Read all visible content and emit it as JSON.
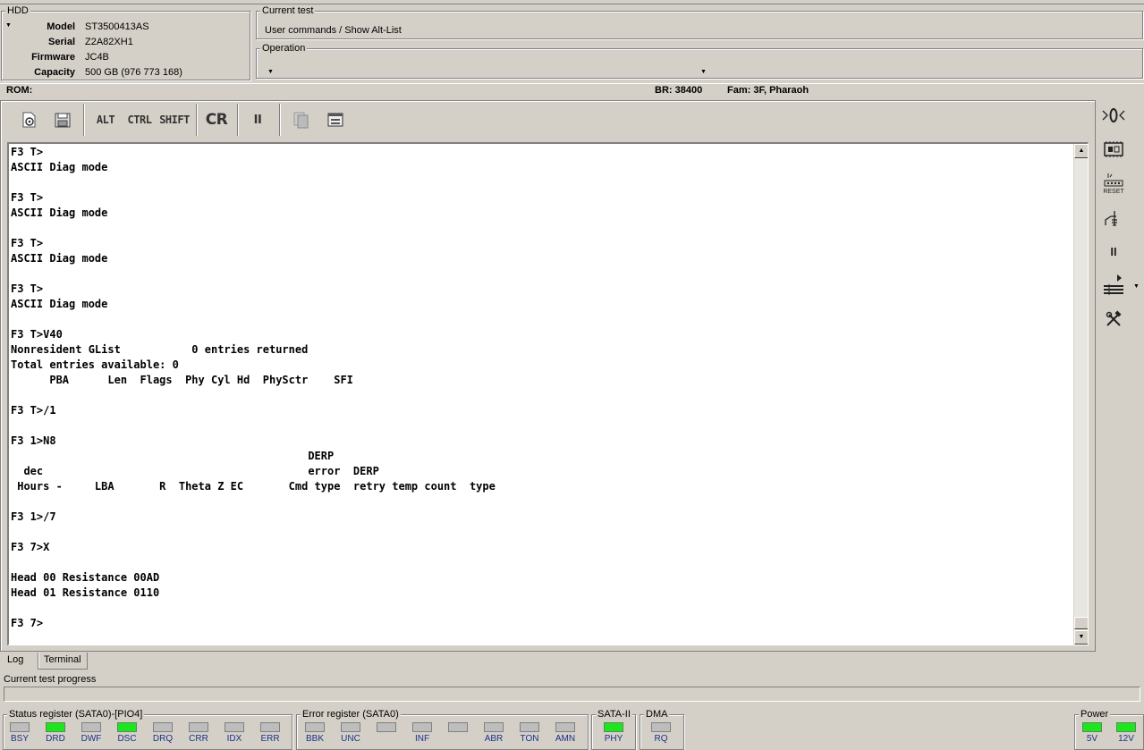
{
  "hdd": {
    "title": "HDD",
    "rows": [
      {
        "label": "Model",
        "value": "ST3500413AS"
      },
      {
        "label": "Serial",
        "value": "Z2A82XH1"
      },
      {
        "label": "Firmware",
        "value": "JC4B"
      },
      {
        "label": "Capacity",
        "value": "500 GB (976 773 168)"
      }
    ]
  },
  "current_test": {
    "title": "Current test",
    "value": "User commands / Show Alt-List"
  },
  "operation": {
    "title": "Operation",
    "value": ""
  },
  "infobar": {
    "rom": "ROM:",
    "br": "BR: 38400",
    "fam": "Fam: 3F, Pharaoh"
  },
  "toolbar": {
    "alt": "ALT",
    "ctrl": "CTRL",
    "shift": "SHIFT",
    "cr": "CR",
    "pause": "II"
  },
  "terminal": {
    "lines": [
      "F3 T>",
      "ASCII Diag mode",
      "",
      "F3 T>",
      "ASCII Diag mode",
      "",
      "F3 T>",
      "ASCII Diag mode",
      "",
      "F3 T>",
      "ASCII Diag mode",
      "",
      "F3 T>V40",
      "Nonresident GList           0 entries returned",
      "Total entries available: 0",
      "      PBA      Len  Flags  Phy Cyl Hd  PhySctr    SFI",
      "",
      "F3 T>/1",
      "",
      "F3 1>N8",
      "                                              DERP",
      "  dec                                         error  DERP",
      " Hours -     LBA       R  Theta Z EC       Cmd type  retry temp count  type",
      "",
      "F3 1>/7",
      "",
      "F3 7>X",
      "",
      "Head 00 Resistance 00AD",
      "Head 01 Resistance 0110",
      "",
      "F3 7>"
    ]
  },
  "side": {
    "reset_label": "RESET",
    "pause": "II"
  },
  "tabs": {
    "log": "Log",
    "terminal": "Terminal"
  },
  "progress": {
    "label": "Current test progress",
    "value": 0
  },
  "status_register": {
    "title": "Status register (SATA0)-[PIO4]",
    "items": [
      {
        "label": "BSY",
        "on": false
      },
      {
        "label": "DRD",
        "on": true
      },
      {
        "label": "DWF",
        "on": false
      },
      {
        "label": "DSC",
        "on": true
      },
      {
        "label": "DRQ",
        "on": false
      },
      {
        "label": "CRR",
        "on": false
      },
      {
        "label": "IDX",
        "on": false
      },
      {
        "label": "ERR",
        "on": false
      }
    ]
  },
  "error_register": {
    "title": "Error register (SATA0)",
    "items": [
      {
        "label": "BBK",
        "on": false
      },
      {
        "label": "UNC",
        "on": false
      },
      {
        "label": "",
        "on": false
      },
      {
        "label": "INF",
        "on": false
      },
      {
        "label": "",
        "on": false
      },
      {
        "label": "ABR",
        "on": false
      },
      {
        "label": "TON",
        "on": false
      },
      {
        "label": "AMN",
        "on": false
      }
    ]
  },
  "sata2": {
    "title": "SATA-II",
    "items": [
      {
        "label": "PHY",
        "on": true
      }
    ]
  },
  "dma": {
    "title": "DMA",
    "items": [
      {
        "label": "RQ",
        "on": false
      }
    ]
  },
  "power": {
    "title": "Power",
    "items": [
      {
        "label": "5V",
        "on": true
      },
      {
        "label": "12V",
        "on": true
      }
    ]
  },
  "colors": {
    "led_on": "#1ee61e",
    "led_off": "#bdbdbd",
    "led_label": "#1c2f8a",
    "chrome": "#d4d0c8"
  }
}
